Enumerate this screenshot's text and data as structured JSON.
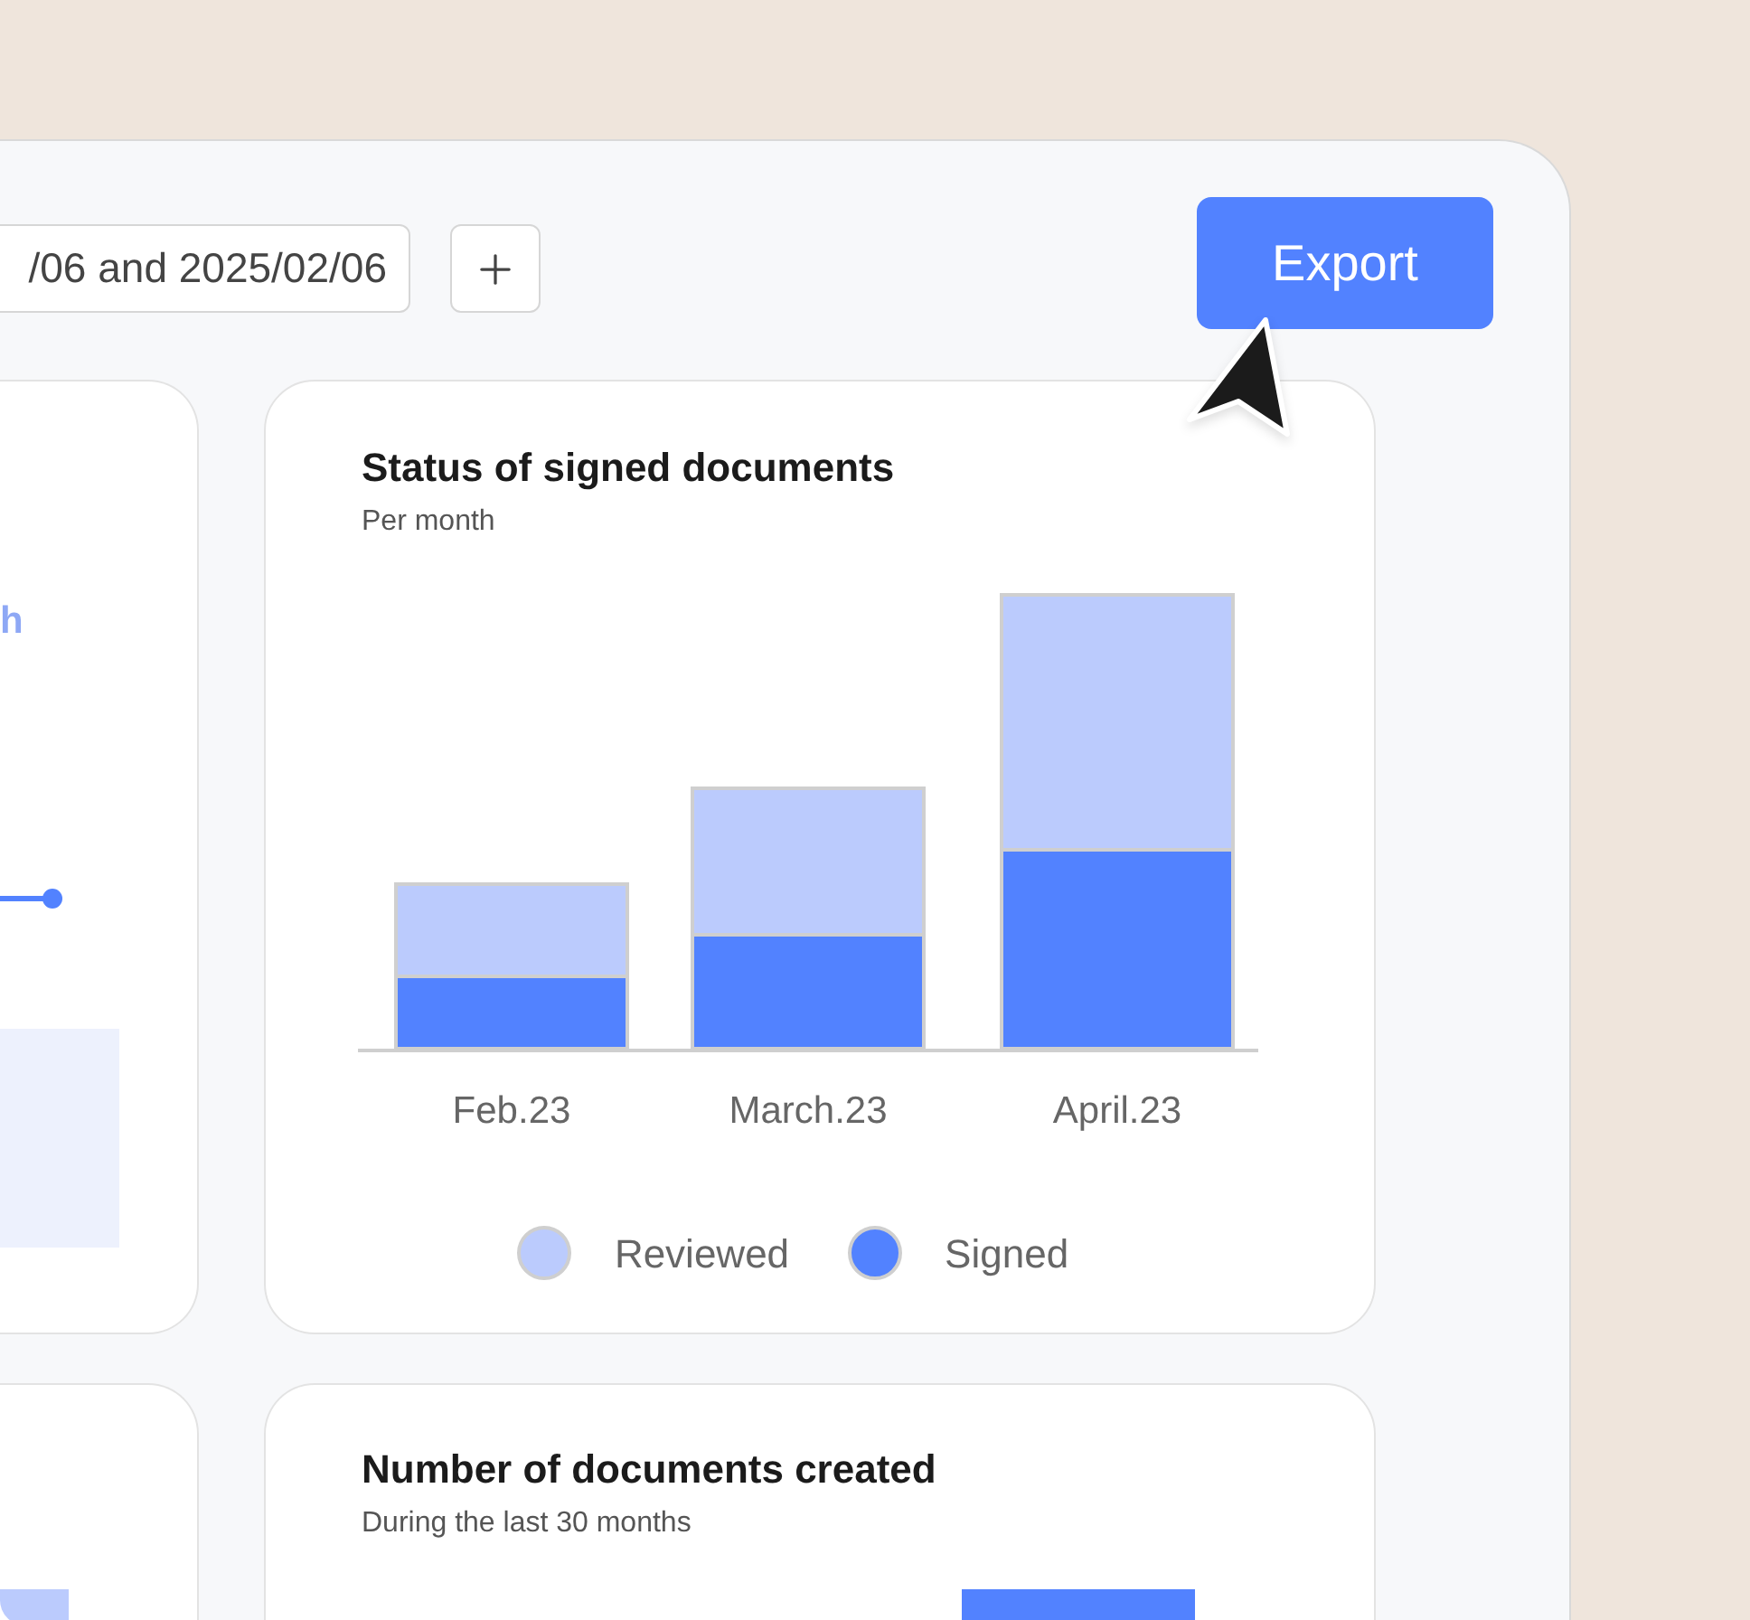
{
  "toolbar": {
    "date_range": "/06 and 2025/02/06",
    "export_button": "Export"
  },
  "left_card": {
    "heading_fragment": "h"
  },
  "cards": [
    {
      "title": "Status of signed documents",
      "subtitle": "Per month",
      "categories": [
        "Feb.23",
        "March.23",
        "April.23"
      ],
      "legend": [
        {
          "label": "Reviewed",
          "color": "#bbcbfd"
        },
        {
          "label": "Signed",
          "color": "#5282ff"
        }
      ]
    },
    {
      "title": "Number of documents created",
      "subtitle": "During the last 30 months"
    }
  ]
}
